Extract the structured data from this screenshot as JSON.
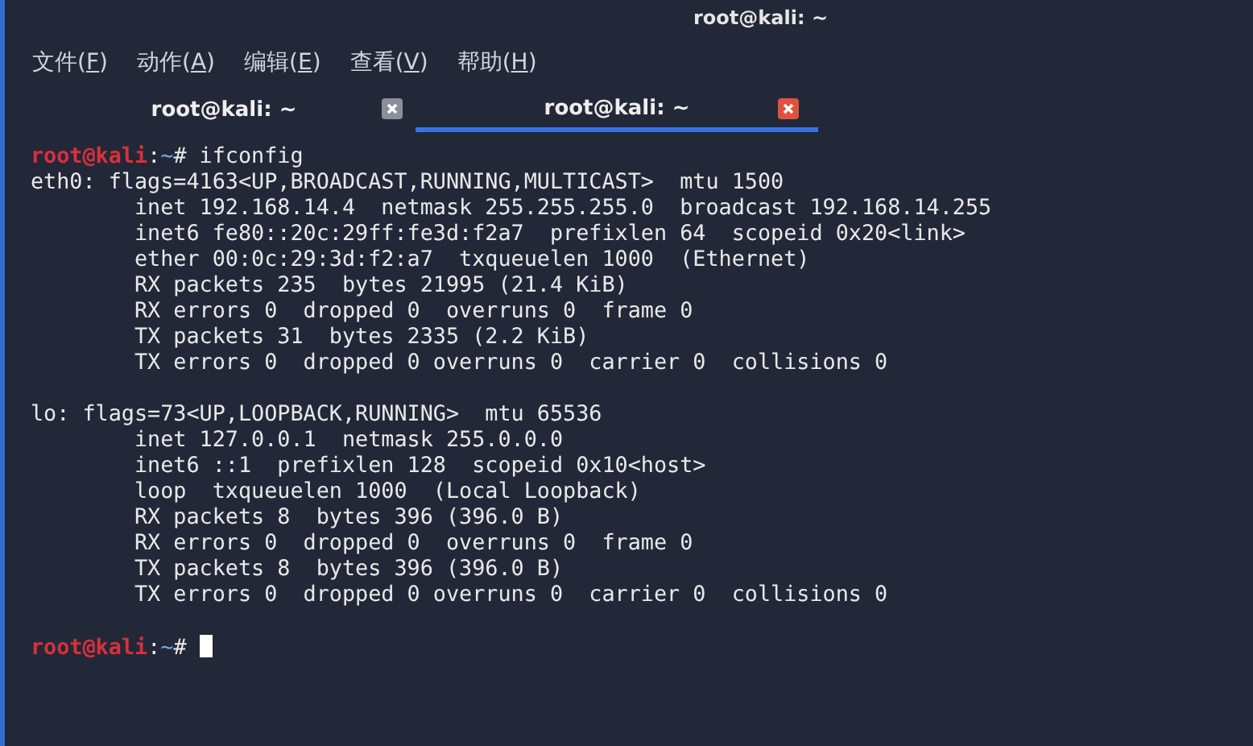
{
  "window": {
    "title": "root@kali: ~"
  },
  "menu": [
    {
      "label": "文件(",
      "key": "F",
      "end": ")"
    },
    {
      "label": "动作(",
      "key": "A",
      "end": ")"
    },
    {
      "label": "编辑(",
      "key": "E",
      "end": ")"
    },
    {
      "label": "查看(",
      "key": "V",
      "end": ")"
    },
    {
      "label": "帮助(",
      "key": "H",
      "end": ")"
    }
  ],
  "tabs": [
    {
      "label": "root@kali: ~",
      "selected": false
    },
    {
      "label": "root@kali: ~",
      "selected": true
    }
  ],
  "terminal": {
    "lines": [
      {
        "kind": "prompt",
        "user": "root@kali",
        "sep": ":",
        "path": "~",
        "symbol": "#",
        "command": "ifconfig",
        "cursor": false
      },
      {
        "kind": "output",
        "text": "eth0: flags=4163<UP,BROADCAST,RUNNING,MULTICAST>  mtu 1500"
      },
      {
        "kind": "output",
        "text": "        inet 192.168.14.4  netmask 255.255.255.0  broadcast 192.168.14.255"
      },
      {
        "kind": "output",
        "text": "        inet6 fe80::20c:29ff:fe3d:f2a7  prefixlen 64  scopeid 0x20<link>"
      },
      {
        "kind": "output",
        "text": "        ether 00:0c:29:3d:f2:a7  txqueuelen 1000  (Ethernet)"
      },
      {
        "kind": "output",
        "text": "        RX packets 235  bytes 21995 (21.4 KiB)"
      },
      {
        "kind": "output",
        "text": "        RX errors 0  dropped 0  overruns 0  frame 0"
      },
      {
        "kind": "output",
        "text": "        TX packets 31  bytes 2335 (2.2 KiB)"
      },
      {
        "kind": "output",
        "text": "        TX errors 0  dropped 0 overruns 0  carrier 0  collisions 0"
      },
      {
        "kind": "blank"
      },
      {
        "kind": "output",
        "text": "lo: flags=73<UP,LOOPBACK,RUNNING>  mtu 65536"
      },
      {
        "kind": "output",
        "text": "        inet 127.0.0.1  netmask 255.0.0.0"
      },
      {
        "kind": "output",
        "text": "        inet6 ::1  prefixlen 128  scopeid 0x10<host>"
      },
      {
        "kind": "output",
        "text": "        loop  txqueuelen 1000  (Local Loopback)"
      },
      {
        "kind": "output",
        "text": "        RX packets 8  bytes 396 (396.0 B)"
      },
      {
        "kind": "output",
        "text": "        RX errors 0  dropped 0  overruns 0  frame 0"
      },
      {
        "kind": "output",
        "text": "        TX packets 8  bytes 396 (396.0 B)"
      },
      {
        "kind": "output",
        "text": "        TX errors 0  dropped 0 overruns 0  carrier 0  collisions 0"
      },
      {
        "kind": "blank"
      },
      {
        "kind": "prompt",
        "user": "root@kali",
        "sep": ":",
        "path": "~",
        "symbol": "#",
        "cursor": true
      }
    ]
  }
}
